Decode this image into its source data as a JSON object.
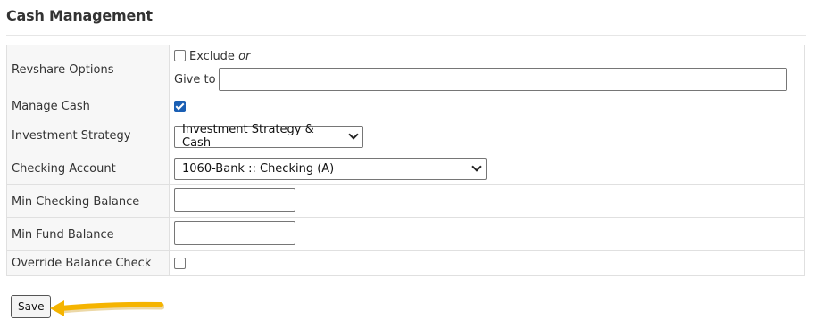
{
  "section": {
    "title": "Cash Management"
  },
  "form": {
    "revshare": {
      "label": "Revshare Options",
      "exclude_label": "Exclude",
      "or_text": "or",
      "give_to_label": "Give to",
      "give_to_value": "",
      "exclude_checked": false
    },
    "manage_cash": {
      "label": "Manage Cash",
      "checked": true
    },
    "investment_strategy": {
      "label": "Investment Strategy",
      "selected": "Investment Strategy & Cash"
    },
    "checking_account": {
      "label": "Checking Account",
      "selected": "1060-Bank :: Checking (A)"
    },
    "min_checking_balance": {
      "label": "Min Checking Balance",
      "value": ""
    },
    "min_fund_balance": {
      "label": "Min Fund Balance",
      "value": ""
    },
    "override_balance_check": {
      "label": "Override Balance Check",
      "checked": false
    }
  },
  "actions": {
    "save_label": "Save"
  },
  "annotation": {
    "arrow_color": "#f5b400",
    "arrow_icon": "arrow-left-icon"
  }
}
